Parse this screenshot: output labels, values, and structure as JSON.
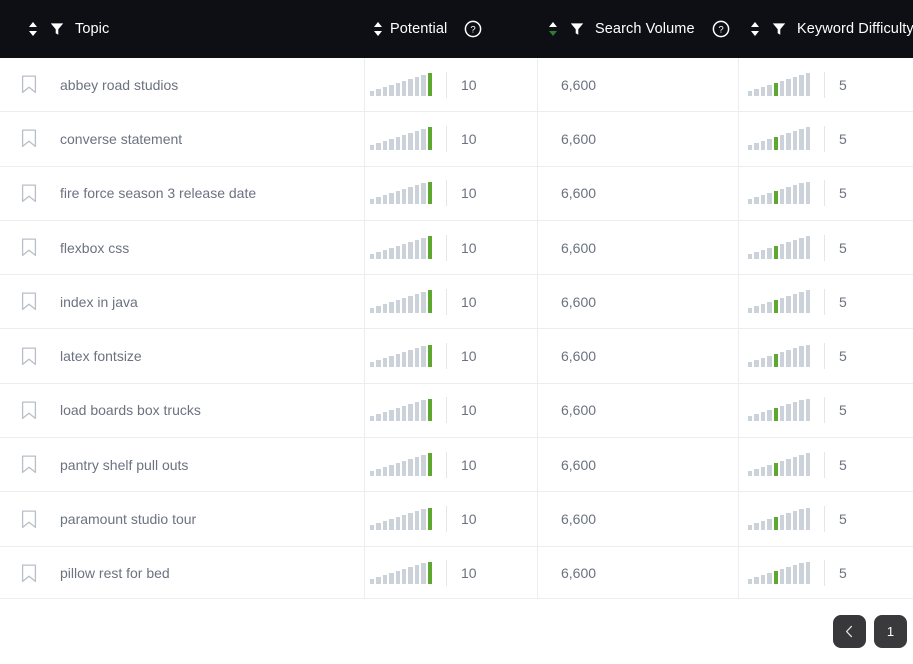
{
  "table": {
    "columns": [
      {
        "key": "topic",
        "label": "Topic",
        "icons": [
          "sort-icon",
          "filter-icon"
        ],
        "sort_state": "none",
        "has_help": false
      },
      {
        "key": "potential",
        "label": "Potential",
        "icons": [
          "sort-icon",
          "help-icon"
        ],
        "sort_state": "none",
        "has_help": true
      },
      {
        "key": "volume",
        "label": "Search Volume",
        "icons": [
          "sort-icon",
          "filter-icon",
          "help-icon"
        ],
        "sort_state": "descending",
        "has_help": true
      },
      {
        "key": "kd",
        "label": "Keyword Difficulty",
        "icons": [
          "sort-icon",
          "filter-icon",
          "help-icon"
        ],
        "sort_state": "none",
        "has_help": true
      }
    ],
    "rows": [
      {
        "topic": "abbey road studios",
        "bookmark": "bookmark-icon",
        "potential": "10",
        "potential_level": 10,
        "volume": "6,600",
        "kd": "5",
        "kd_level": 5
      },
      {
        "topic": "converse statement",
        "bookmark": "bookmark-icon",
        "potential": "10",
        "potential_level": 10,
        "volume": "6,600",
        "kd": "5",
        "kd_level": 5
      },
      {
        "topic": "fire force season 3 release date",
        "bookmark": "bookmark-icon",
        "potential": "10",
        "potential_level": 10,
        "volume": "6,600",
        "kd": "5",
        "kd_level": 5
      },
      {
        "topic": "flexbox css",
        "bookmark": "bookmark-icon",
        "potential": "10",
        "potential_level": 10,
        "volume": "6,600",
        "kd": "5",
        "kd_level": 5
      },
      {
        "topic": "index in java",
        "bookmark": "bookmark-icon",
        "potential": "10",
        "potential_level": 10,
        "volume": "6,600",
        "kd": "5",
        "kd_level": 5
      },
      {
        "topic": "latex fontsize",
        "bookmark": "bookmark-icon",
        "potential": "10",
        "potential_level": 10,
        "volume": "6,600",
        "kd": "5",
        "kd_level": 5
      },
      {
        "topic": "load boards box trucks",
        "bookmark": "bookmark-icon",
        "potential": "10",
        "potential_level": 10,
        "volume": "6,600",
        "kd": "5",
        "kd_level": 5
      },
      {
        "topic": "pantry shelf pull outs",
        "bookmark": "bookmark-icon",
        "potential": "10",
        "potential_level": 10,
        "volume": "6,600",
        "kd": "5",
        "kd_level": 5
      },
      {
        "topic": "paramount studio tour",
        "bookmark": "bookmark-icon",
        "potential": "10",
        "potential_level": 10,
        "volume": "6,600",
        "kd": "5",
        "kd_level": 5
      },
      {
        "topic": "pillow rest for bed",
        "bookmark": "bookmark-icon",
        "potential": "10",
        "potential_level": 10,
        "volume": "6,600",
        "kd": "5",
        "kd_level": 5
      }
    ]
  },
  "pagination": {
    "prev_label": "‹",
    "prev_icon": "chevron-left-icon",
    "pages": [
      "1"
    ],
    "current_page": "1"
  },
  "colors": {
    "header_bg": "#0d0f14",
    "accent_green": "#5ea832",
    "bar_gray": "#ccd2da",
    "text_gray": "#6b7280",
    "row_border": "#ebedf0",
    "page_btn_bg": "#38383a"
  }
}
